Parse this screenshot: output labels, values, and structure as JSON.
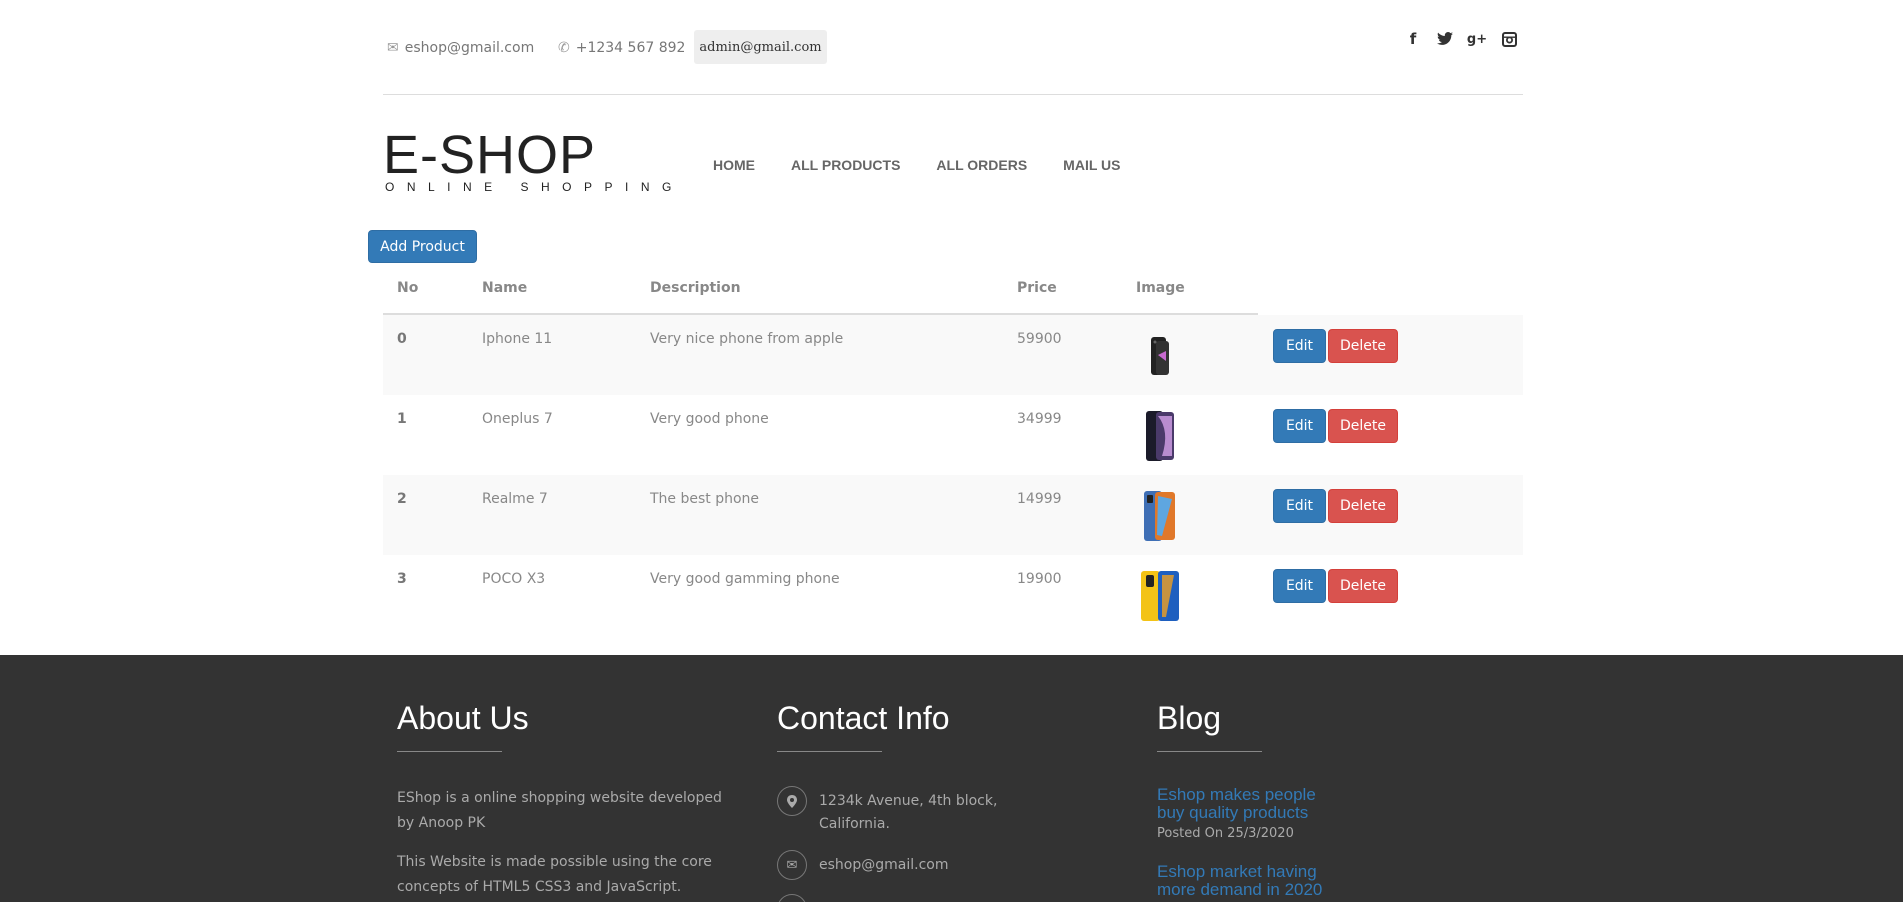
{
  "topbar": {
    "email": "eshop@gmail.com",
    "phone": "+1234 567 892",
    "admin": "admin@gmail.com",
    "social": [
      "facebook-icon",
      "twitter-icon",
      "google-plus-icon",
      "instagram-icon"
    ]
  },
  "logo": {
    "main": "E-SHOP",
    "sub": "ONLINE SHOPPING"
  },
  "nav": [
    "HOME",
    "ALL PRODUCTS",
    "ALL ORDERS",
    "MAIL US"
  ],
  "add_button": "Add Product",
  "table": {
    "headers": [
      "No",
      "Name",
      "Description",
      "Price",
      "Image"
    ],
    "rows": [
      {
        "no": "0",
        "name": "Iphone 11",
        "desc": "Very nice phone from apple",
        "price": "59900"
      },
      {
        "no": "1",
        "name": "Oneplus 7",
        "desc": "Very good phone",
        "price": "34999"
      },
      {
        "no": "2",
        "name": "Realme 7",
        "desc": "The best phone",
        "price": "14999"
      },
      {
        "no": "3",
        "name": "POCO X3",
        "desc": "Very good gamming phone",
        "price": "19900"
      }
    ],
    "edit_label": "Edit",
    "delete_label": "Delete"
  },
  "footer": {
    "about": {
      "title": "About Us",
      "p1": "EShop is a online shopping website developed by Anoop PK",
      "p2": "This Website is made possible using the core concepts of HTML5 CSS3 and JavaScript."
    },
    "contact": {
      "title": "Contact Info",
      "address": "1234k Avenue, 4th block, California.",
      "email": "eshop@gmail.com"
    },
    "blog": {
      "title": "Blog",
      "post1_title": "Eshop makes people buy quality products",
      "post1_date": "Posted On 25/3/2020",
      "post2_title": "Eshop market having more demand in 2020"
    }
  },
  "colors": {
    "primary": "#337ab7",
    "danger": "#d9534f",
    "footer_bg": "#333333"
  }
}
